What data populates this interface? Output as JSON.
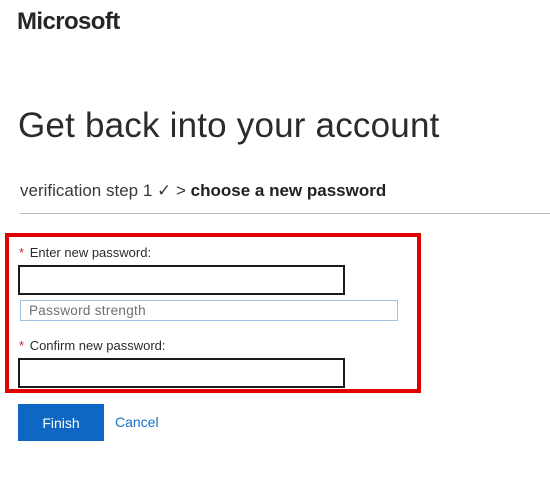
{
  "brand": {
    "logo_text": "Microsoft"
  },
  "page": {
    "title": "Get back into your account"
  },
  "steps": {
    "previous": "verification step 1 ✓ >",
    "current": "choose a new password"
  },
  "form": {
    "new_password_required": "*",
    "new_password_label": "Enter new password:",
    "new_password_value": "",
    "strength_label": "Password strength",
    "confirm_password_required": "*",
    "confirm_password_label": "Confirm new password:",
    "confirm_password_value": ""
  },
  "actions": {
    "finish_label": "Finish",
    "cancel_label": "Cancel"
  },
  "colors": {
    "highlight_border": "#e00000",
    "primary_button": "#0e67c2",
    "link": "#1a6fc4",
    "required_marker": "#d0201c"
  }
}
